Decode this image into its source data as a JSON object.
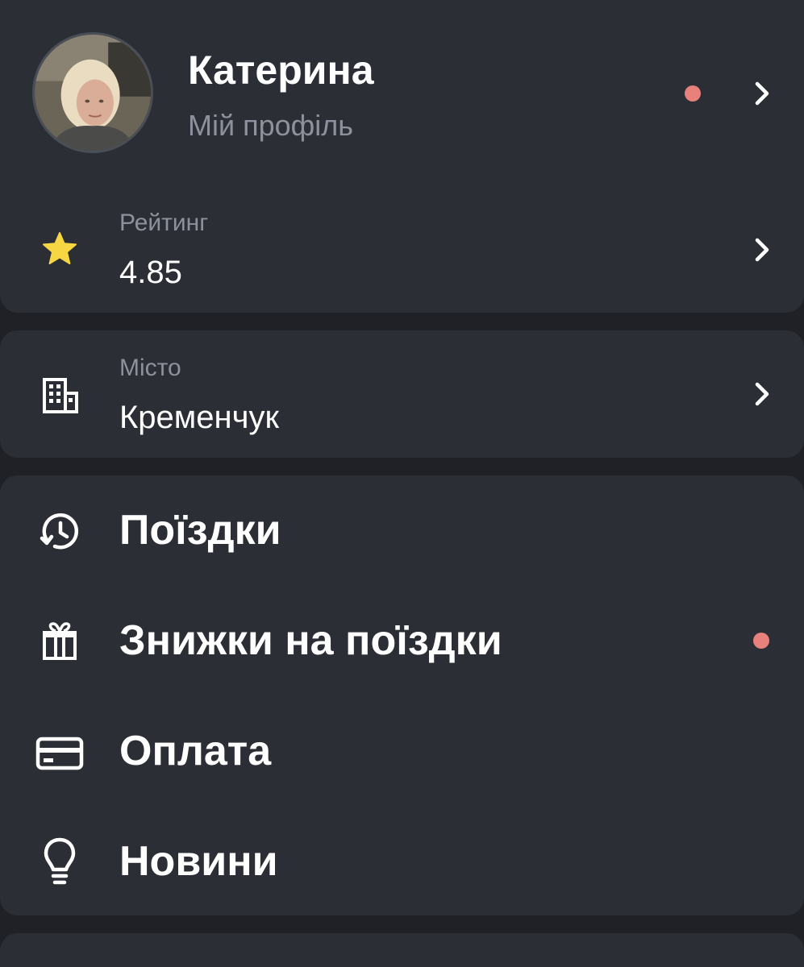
{
  "profile": {
    "name": "Катерина",
    "subtitle": "Мій профіль",
    "avatar_icon": "user-photo",
    "has_notification": true
  },
  "rating": {
    "label": "Рейтинг",
    "value": "4.85",
    "icon": "star-icon"
  },
  "city": {
    "label": "Місто",
    "value": "Кременчук",
    "icon": "building-icon"
  },
  "menu": {
    "items": [
      {
        "label": "Поїздки",
        "icon": "history-icon",
        "has_notification": false
      },
      {
        "label": "Знижки на поїздки",
        "icon": "gift-icon",
        "has_notification": true
      },
      {
        "label": "Оплата",
        "icon": "credit-card-icon",
        "has_notification": false
      },
      {
        "label": "Новини",
        "icon": "lightbulb-icon",
        "has_notification": false
      }
    ]
  },
  "colors": {
    "background": "#1f2126",
    "card": "#2b2e35",
    "secondary_text": "#8d919b",
    "notification_dot": "#e8807c",
    "star": "#f6d743"
  }
}
